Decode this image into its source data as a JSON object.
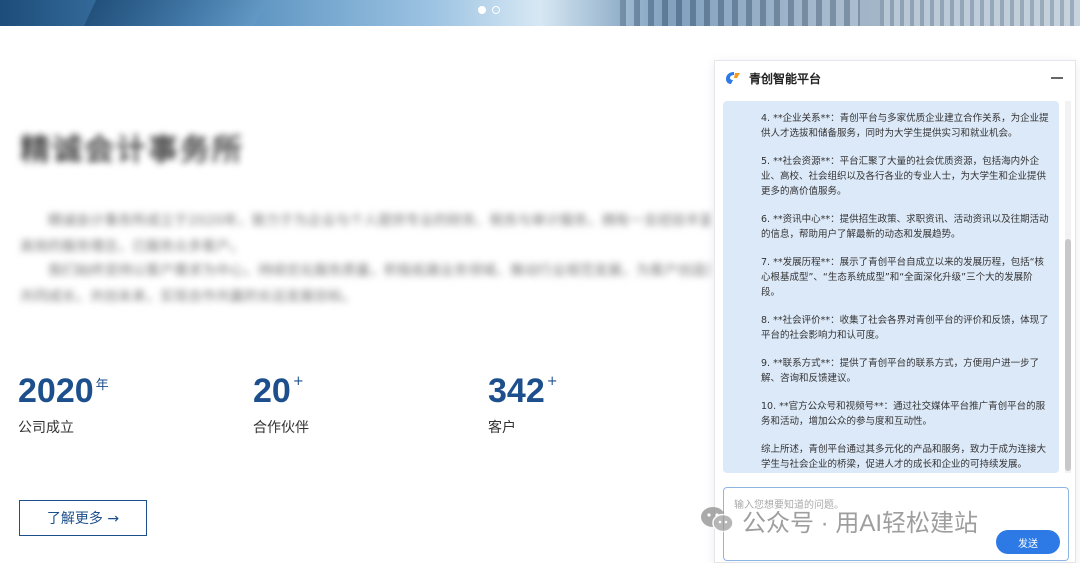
{
  "hero": {
    "slides": [
      "slide-1",
      "slide-2"
    ],
    "active_slide": 1
  },
  "main": {
    "title": "精诚会计事务所",
    "paragraphs": [
      "精诚会计事务所成立于2020年，致力于为企业与个人提供专业的财务、税务与审计服务，拥有一支经验丰富的专业团队，秉持诚信、专业、",
      "高效的服务理念，已服务众多客户。",
      "我们始终坚持以客户需求为中心，持续优化服务质量，积极拓展业务领域，推动行业规范发展，为客户创造更大价值，",
      "共同成长，共创未来，实现合作共赢的长远发展目标。"
    ],
    "stats": [
      {
        "value": "2020",
        "suffix": "年",
        "label": "公司成立"
      },
      {
        "value": "20",
        "suffix": "+",
        "label": "合作伙伴"
      },
      {
        "value": "342",
        "suffix": "+",
        "label": "客户"
      }
    ],
    "more_button": "了解更多 →"
  },
  "chat": {
    "title": "青创智能平台",
    "messages": [
      "4. **企业关系**：青创平台与多家优质企业建立合作关系，为企业提供人才选拔和储备服务，同时为大学生提供实习和就业机会。",
      "5. **社会资源**：平台汇聚了大量的社会优质资源，包括海内外企业、高校、社会组织以及各行各业的专业人士，为大学生和企业提供更多的高价值服务。",
      "6. **资讯中心**：提供招生政策、求职资讯、活动资讯以及往期活动的信息，帮助用户了解最新的动态和发展趋势。",
      "7. **发展历程**：展示了青创平台自成立以来的发展历程，包括“核心根基成型”、“生态系统成型”和“全面深化升级”三个大的发展阶段。",
      "8. **社会评价**：收集了社会各界对青创平台的评价和反馈，体现了平台的社会影响力和认可度。",
      "9. **联系方式**：提供了青创平台的联系方式，方便用户进一步了解、咨询和反馈建议。",
      "10. **官方公众号和视频号**：通过社交媒体平台推广青创平台的服务和活动，增加公众的参与度和互动性。",
      "综上所述，青创平台通过其多元化的产品和服务，致力于成为连接大学生与社会企业的桥梁，促进人才的成长和企业的可持续发展。"
    ],
    "input_placeholder": "输入您想要知道的问题。",
    "send_label": "发送"
  },
  "watermark": {
    "text": "公众号 · 用AI轻松建站"
  },
  "colors": {
    "accent": "#1c4f8c",
    "send": "#2d79e6",
    "bubble": "#dce9f8"
  }
}
